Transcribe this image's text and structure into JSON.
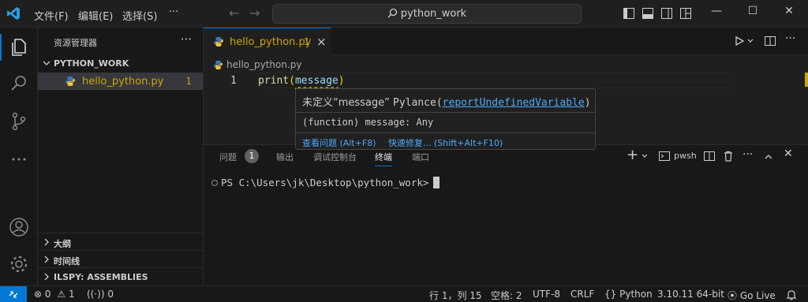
{
  "menu": {
    "file": "文件(F)",
    "edit": "编辑(E)",
    "selection": "选择(S)",
    "more": "···"
  },
  "search": {
    "text": "python_work"
  },
  "sidebar": {
    "title": "资源管理器",
    "more": "···",
    "folder": "PYTHON_WORK",
    "file": {
      "name": "hello_python.py",
      "badge": "1"
    },
    "sections": [
      "大纲",
      "时间线",
      "ILSPY: ASSEMBLIES"
    ]
  },
  "editor": {
    "tab": {
      "label": "hello_python.py",
      "badge": "1",
      "close": "×"
    },
    "breadcrumb": "hello_python.py",
    "line_number": "1",
    "code": {
      "fn": "print",
      "open": "(",
      "var": "message",
      "close": ")"
    }
  },
  "hover": {
    "message": "未定义“message”",
    "source": "Pylance",
    "rule": "reportUndefinedVariable",
    "signature": "(function) message: Any",
    "view_problem": "查看问题 (Alt+F8)",
    "quick_fix": "快速修复... (Shift+Alt+F10)"
  },
  "panel": {
    "tabs": {
      "problems": "问题",
      "output": "输出",
      "debug": "调试控制台",
      "terminal": "终端",
      "ports": "端口"
    },
    "problems_count": "1",
    "shell": "pwsh",
    "prompt": "PS C:\\Users\\jk\\Desktop\\python_work>"
  },
  "status": {
    "errors": "0",
    "warnings": "1",
    "ports": "0",
    "position": "行 1，列 15",
    "spaces": "空格: 2",
    "encoding": "UTF-8",
    "eol": "CRLF",
    "language": "Python",
    "interpreter": "3.10.11 64-bit",
    "golive": "Go Live"
  },
  "colors": {
    "accent": "#0078d4",
    "warning": "#cca700",
    "link": "#4daafc"
  }
}
